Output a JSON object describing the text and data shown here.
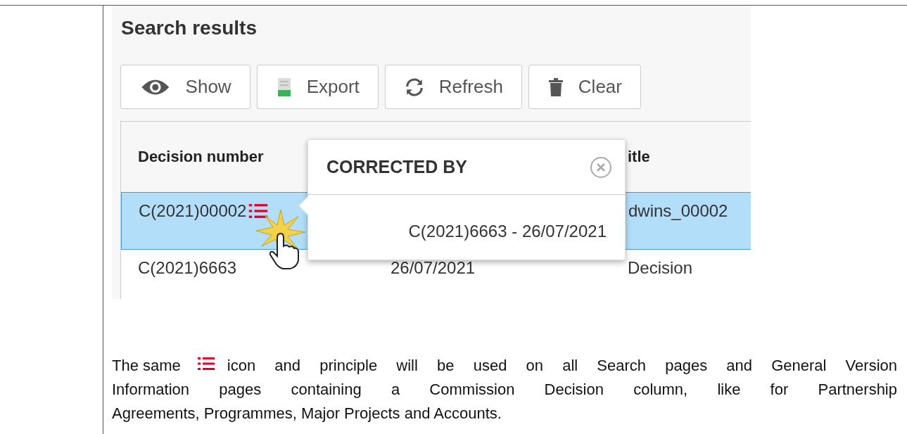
{
  "heading": "Search results",
  "toolbar": [
    {
      "kind": "show",
      "label": "Show"
    },
    {
      "kind": "export",
      "label": "Export"
    },
    {
      "kind": "refresh",
      "label": "Refresh"
    },
    {
      "kind": "clear",
      "label": "Clear"
    }
  ],
  "table": {
    "columns": [
      {
        "label": "Decision number"
      },
      {},
      {
        "label": "itle"
      }
    ],
    "rows": [
      {
        "selected": true,
        "has_corrections": true,
        "cells": [
          "C(2021)00002",
          null,
          "dwins_00002"
        ]
      },
      {
        "selected": false,
        "has_corrections": false,
        "cells": [
          "C(2021)6663",
          "26/07/2021",
          "Decision"
        ]
      }
    ]
  },
  "popup": {
    "title": "CORRECTED BY",
    "items": [
      "C(2021)6663 - 26/07/2021"
    ]
  },
  "paragraph": {
    "before": "The same",
    "lines": [
      "icon and principle will be used on all Search pages and General Version",
      "Information pages containing a Commission Decision column, like for Partnership",
      "Agreements, Programmes, Major Projects and Accounts."
    ]
  }
}
